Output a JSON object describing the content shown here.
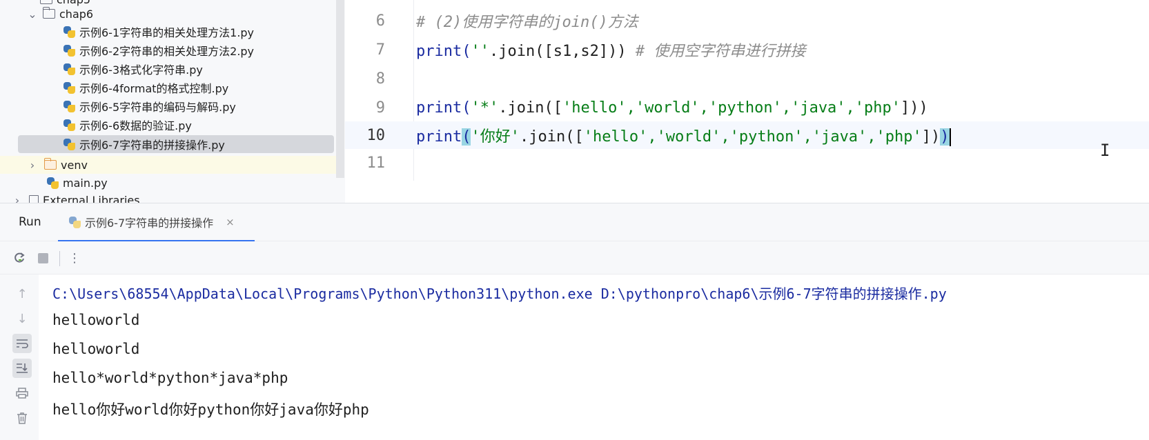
{
  "project_tree": {
    "partial_top": "chap5",
    "folder": "chap6",
    "files": [
      "示例6-1字符串的相关处理方法1.py",
      "示例6-2字符串的相关处理方法2.py",
      "示例6-3格式化字符串.py",
      "示例6-4format的格式控制.py",
      "示例6-5字符串的编码与解码.py",
      "示例6-6数据的验证.py",
      "示例6-7字符串的拼接操作.py"
    ],
    "venv": "venv",
    "main": "main.py",
    "external": "External Libraries"
  },
  "editor": {
    "lines": [
      {
        "no": "6",
        "comment": "# (2)使用字符串的join()方法"
      },
      {
        "no": "7",
        "a": "print(",
        "s": "''",
        "b": ".join([s1,s2]))",
        "comment": " # 使用空字符串进行拼接"
      },
      {
        "no": "8"
      },
      {
        "no": "9",
        "a": "print(",
        "s1": "'*'",
        "b": ".join([",
        "items": "'hello','world','python','java','php'",
        "c": "]))"
      },
      {
        "no": "10",
        "a": "print",
        "open": "(",
        "s1": "'你好'",
        "b": ".join([",
        "items": "'hello','world','python','java','php'",
        "c": "])",
        "close": ")"
      },
      {
        "no": "11"
      }
    ]
  },
  "run": {
    "label": "Run",
    "tab": "示例6-7字符串的拼接操作",
    "close": "×"
  },
  "console": {
    "command": "C:\\Users\\68554\\AppData\\Local\\Programs\\Python\\Python311\\python.exe D:\\pythonpro\\chap6\\示例6-7字符串的拼接操作.py",
    "output": [
      "helloworld",
      "helloworld",
      "hello*world*python*java*php",
      "hello你好world你好python你好java你好php"
    ]
  }
}
